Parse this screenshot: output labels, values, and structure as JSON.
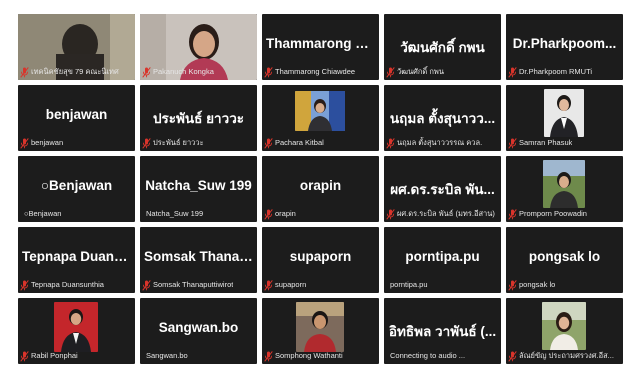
{
  "colors": {
    "tile_bg": "#1c1c1c",
    "mic_muted": "#d9342b",
    "speaker_outline": "#6fd36f",
    "name_text": "#ffffff"
  },
  "participants": [
    {
      "display": "",
      "label": "เทคนิคชัยสุข 79 คณะนิเทศ",
      "mic": "muted",
      "video": "webcam-dim"
    },
    {
      "display": "",
      "label": "Pakanuch Kongka",
      "mic": "muted",
      "video": "webcam-woman"
    },
    {
      "display": "Thammarong C...",
      "label": "Thammarong Chiawdee",
      "mic": "muted",
      "video": "off"
    },
    {
      "display": "วัฒนศักดิ์ กพน",
      "label": "วัฒนศักดิ์ กพน",
      "mic": "muted",
      "video": "off"
    },
    {
      "display": "Dr.Pharkpoom...",
      "label": "Dr.Pharkpoom RMUTi",
      "mic": "muted",
      "video": "off"
    },
    {
      "display": "benjawan",
      "label": "benjawan",
      "mic": "muted",
      "video": "off"
    },
    {
      "display": "ประพันธ์ ยาววะ",
      "label": "ประพันธ์ ยาววะ",
      "mic": "muted",
      "video": "off"
    },
    {
      "display": "",
      "label": "Pachara Kitbal",
      "mic": "muted",
      "video": "photo-flags"
    },
    {
      "display": "นฤมล ตั้งสุนาวว...",
      "label": "นฤมล ตั้งสุนาววรรณ ควล.",
      "mic": "muted",
      "video": "off"
    },
    {
      "display": "",
      "label": "Samran Phasuk",
      "mic": "muted",
      "video": "photo-suit"
    },
    {
      "display": "○Benjawan",
      "label": "○Benjawan",
      "mic": "none",
      "video": "off"
    },
    {
      "display": "Natcha_Suw 199",
      "label": "Natcha_Suw 199",
      "mic": "none",
      "video": "off"
    },
    {
      "display": "orapin",
      "label": "orapin",
      "mic": "muted",
      "video": "off"
    },
    {
      "display": "ผศ.ดร.ระบิล พัน...",
      "label": "ผศ.ดร.ระบิล พันธ์ (มทร.อีสาน)",
      "mic": "muted",
      "video": "off"
    },
    {
      "display": "",
      "label": "Promporn Poowadin",
      "mic": "muted",
      "video": "photo-outdoor"
    },
    {
      "display": "Tepnapa Duans...",
      "label": "Tepnapa Duansunthia",
      "mic": "muted",
      "video": "off"
    },
    {
      "display": "Somsak Thanap...",
      "label": "Somsak Thanaputtiwirot",
      "mic": "muted",
      "video": "off"
    },
    {
      "display": "supaporn",
      "label": "supaporn",
      "mic": "muted",
      "video": "off"
    },
    {
      "display": "porntipa.pu",
      "label": "porntipa.pu",
      "mic": "none",
      "video": "off"
    },
    {
      "display": "pongsak lo",
      "label": "pongsak lo",
      "mic": "muted",
      "video": "off"
    },
    {
      "display": "",
      "label": "Rabil Ponphai",
      "mic": "muted",
      "video": "photo-red"
    },
    {
      "display": "Sangwan.bo",
      "label": "Sangwan.bo",
      "mic": "none",
      "video": "off"
    },
    {
      "display": "",
      "label": "Somphong Wathanti",
      "mic": "muted",
      "video": "photo-man"
    },
    {
      "display": "อิทธิพล วาพันธ์ (...",
      "label": "Connecting to audio ...",
      "mic": "none",
      "video": "off"
    },
    {
      "display": "",
      "label": "ลัณย์ขัญ ประถามศรวงศ.อีส...",
      "mic": "muted",
      "video": "photo-woman-outdoor"
    }
  ]
}
